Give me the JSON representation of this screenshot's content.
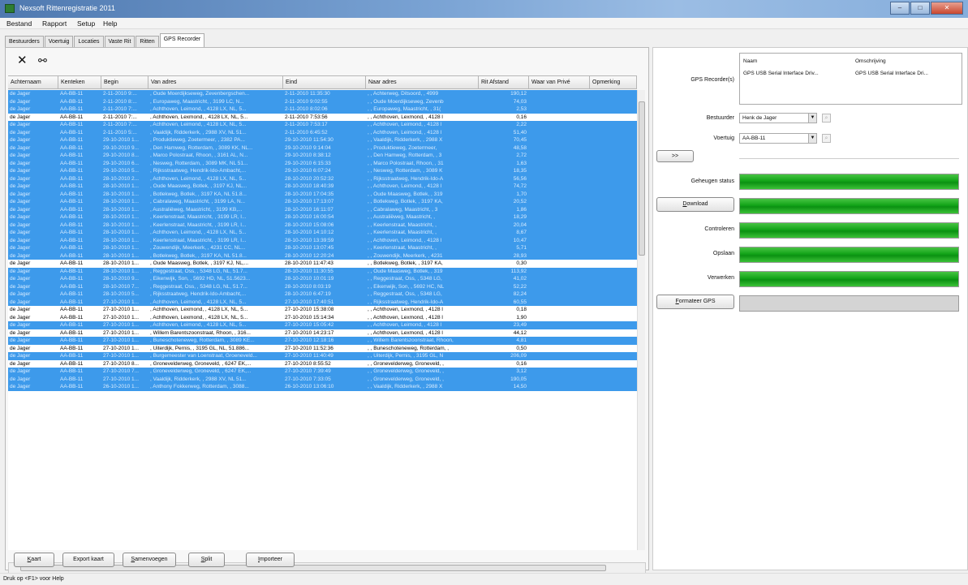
{
  "app": {
    "title": "Nexsoft Rittenregistratie 2011"
  },
  "window_buttons": [
    "–",
    "□",
    "✕"
  ],
  "menu": [
    "Bestand",
    "Rapport",
    "Setup",
    "Help"
  ],
  "tabs": [
    "Bestuurders",
    "Voertuig",
    "Locaties",
    "Vaste Rit",
    "Ritten",
    "GPS Recorder"
  ],
  "active_tab": "GPS Recorder",
  "toolbar": {
    "delete_icon": "close-icon",
    "find_icon": "binoculars-icon"
  },
  "grid": {
    "columns": [
      "Achternaam",
      "Kenteken",
      "Begin",
      "Van adres",
      "Eind",
      "Naar adres",
      "Rit Afstand",
      "Waar van Privé",
      "Opmerking"
    ],
    "rows": [
      {
        "sel": true,
        "name": "de Jager",
        "plate": "AA-BB-11",
        "begin": "2-11-2010 9:...",
        "from": ", Oude Moerdijkseweg, Zevenbergschen...",
        "end": "2-11-2010 11:35:30",
        "to": ", , Achterweg, Ditsoord, , 4999",
        "km": "190,12"
      },
      {
        "sel": true,
        "name": "de Jager",
        "plate": "AA-BB-11",
        "begin": "2-11-2010 8:...",
        "from": ", Europaweg, Maastricht, , 3199 LC, N...",
        "end": "2-11-2010 9:02:55",
        "to": ", , Oude Moerdijkseweg, Zevenb",
        "km": "74,03"
      },
      {
        "sel": true,
        "name": "de Jager",
        "plate": "AA-BB-11",
        "begin": "2-11-2010 7:...",
        "from": ", Achthoven, Leimond, , 4128 LX, NL, 5...",
        "end": "2-11-2010 8:02:06",
        "to": ", , Europaweg, Maastricht, , 31(",
        "km": "2,53"
      },
      {
        "sel": false,
        "name": "de Jager",
        "plate": "AA-BB-11",
        "begin": "2-11-2010 7:...",
        "from": ", Achthoven, Lexmond, , 4128 LX, NL, 5...",
        "end": "2-11-2010 7:53:56",
        "to": ", , Achthoven, Lexmond, , 4128 l",
        "km": "0,16"
      },
      {
        "sel": true,
        "name": "de Jager",
        "plate": "AA-BB-11",
        "begin": "2-11-2010 7:...",
        "from": ", Achthoven, Leimond, , 4128 LX, NL, 5...",
        "end": "2-11-2010 7:53:17",
        "to": ", , Achthoven, Leimond, , 4128 l",
        "km": "2,22"
      },
      {
        "sel": true,
        "name": "de Jager",
        "plate": "AA-BB-11",
        "begin": "2-11-2010 5:...",
        "from": ", Vaaldijk, Ridderkerk, , 2988 XV, NL 51...",
        "end": "2-11-2010 6:45:52",
        "to": ", , Achthoven, Leimond, , 4128 l",
        "km": "51,40"
      },
      {
        "sel": true,
        "name": "de Jager",
        "plate": "AA-BB-11",
        "begin": "29-10-2010 1...",
        "from": ", Produktieweg, Zoetermeer, , 2382 PA...",
        "end": "29-10-2010 11:54:30",
        "to": ", , Vaaldijk, Ridderkerk, , 2988 X",
        "km": "70,45"
      },
      {
        "sel": true,
        "name": "de Jager",
        "plate": "AA-BB-11",
        "begin": "29-10-2010 9...",
        "from": ", Den Hamweg, Rotterdam, , 3089 KK, NL...",
        "end": "29-10-2010 9:14:04",
        "to": ", , Produktieweg, Zoetermeer,",
        "km": "48,58"
      },
      {
        "sel": true,
        "name": "de Jager",
        "plate": "AA-BB-11",
        "begin": "29-10-2010 8...",
        "from": ", Marco Polostraat, Rhoon, , 3161 AL, N...",
        "end": "29-10-2010 8:38:12",
        "to": ", , Den Hamweg, Rotterdam, , 3",
        "km": "2,72"
      },
      {
        "sel": true,
        "name": "de Jager",
        "plate": "AA-BB-11",
        "begin": "29-10-2010 6...",
        "from": ", Nesweg, Rotterdam, , 3089 MK, NL 51...",
        "end": "29-10-2010 6:15:33",
        "to": ", , Marco Polostraat, Rhoon, , 31",
        "km": "1,63"
      },
      {
        "sel": true,
        "name": "de Jager",
        "plate": "AA-BB-11",
        "begin": "29-10-2010 5...",
        "from": ", Rijksstraatweg, Hendrik-Ido-Ambacht,...",
        "end": "29-10-2010 6:07:24",
        "to": ", , Nesweg, Rotterdam, , 3089 K",
        "km": "18,35"
      },
      {
        "sel": true,
        "name": "de Jager",
        "plate": "AA-BB-11",
        "begin": "28-10-2010 2...",
        "from": ", Achthoven, Leimond, , 4128 LX, NL, 5...",
        "end": "28-10-2010 20:52:32",
        "to": ", , Rijksstraatweg, Hendrik-Ido-A",
        "km": "56,56"
      },
      {
        "sel": true,
        "name": "de Jager",
        "plate": "AA-BB-11",
        "begin": "28-10-2010 1...",
        "from": ", Oude Maasweg, Botlek, , 3197 KJ, NL...",
        "end": "28-10-2010 18:40:39",
        "to": ", , Achthoven, Leimond, , 4128 l",
        "km": "74,72"
      },
      {
        "sel": true,
        "name": "de Jager",
        "plate": "AA-BB-11",
        "begin": "28-10-2010 1...",
        "from": ", Botlekweg, Botlek, , 3197 KA, NL 51.8...",
        "end": "28-10-2010 17:04:35",
        "to": ", , Oude Maasweg, Botlek, , 319",
        "km": "1,70"
      },
      {
        "sel": true,
        "name": "de Jager",
        "plate": "AA-BB-11",
        "begin": "28-10-2010 1...",
        "from": ", Cabralaweg, Maastricht, , 3199 LA, N...",
        "end": "28-10-2010 17:13:07",
        "to": ", , Botlekweg, Botlek, , 3197 KA,",
        "km": "20,52"
      },
      {
        "sel": true,
        "name": "de Jager",
        "plate": "AA-BB-11",
        "begin": "28-10-2010 1...",
        "from": ", Australiëweg, Maastricht, , 3199 KB,...",
        "end": "28-10-2010 16:11:07",
        "to": ", , Cabralaweg, Maastricht, , 3",
        "km": "1,86"
      },
      {
        "sel": true,
        "name": "de Jager",
        "plate": "AA-BB-11",
        "begin": "28-10-2010 1...",
        "from": ", Keerlenstraat, Maastricht, , 3199 LR, I...",
        "end": "28-10-2010 16:00:54",
        "to": ", , Australiëweg, Maastricht, ,",
        "km": "18,29"
      },
      {
        "sel": true,
        "name": "de Jager",
        "plate": "AA-BB-11",
        "begin": "28-10-2010 1...",
        "from": ", Keerlenstraat, Maastricht, , 3199 LR, I...",
        "end": "28-10-2010 15:08:06",
        "to": ", , Keerlenstraat, Maastricht, ,",
        "km": "20,04"
      },
      {
        "sel": true,
        "name": "de Jager",
        "plate": "AA-BB-11",
        "begin": "28-10-2010 1...",
        "from": ", Achthoven, Leimond, , 4128 LX, NL, 5...",
        "end": "28-10-2010 14:10:12",
        "to": ", , Keerlenstraat, Maastricht, ,",
        "km": "8,67"
      },
      {
        "sel": true,
        "name": "de Jager",
        "plate": "AA-BB-11",
        "begin": "28-10-2010 1...",
        "from": ", Keerlenstraat, Maastricht, , 3199 LR, I...",
        "end": "28-10-2010 13:39:59",
        "to": ", , Achthoven, Leimond, , 4128 l",
        "km": "10,47"
      },
      {
        "sel": true,
        "name": "de Jager",
        "plate": "AA-BB-11",
        "begin": "28-10-2010 1...",
        "from": ", Zouwendijk, Meerkerk, , 4231 CC, NL...",
        "end": "28-10-2010 13:07:45",
        "to": ", , Keerlenstraat, Maastricht, ,",
        "km": "5,71"
      },
      {
        "sel": true,
        "name": "de Jager",
        "plate": "AA-BB-11",
        "begin": "28-10-2010 1...",
        "from": ", Botlekweg, Botlek, , 3197 KA, NL 51.8...",
        "end": "28-10-2010 12:20:24",
        "to": ", , Zouwendijk, Meerkerk, , 4231",
        "km": "28,93"
      },
      {
        "sel": false,
        "name": "de Jager",
        "plate": "AA-BB-11",
        "begin": "28-10-2010 1...",
        "from": ", Oude Maasweg, Botlek, , 3197 KJ, NL,...",
        "end": "28-10-2010 11:47:43",
        "to": ", , Botlekweg, Botlek, , 3197 KA,",
        "km": "0,30"
      },
      {
        "sel": true,
        "name": "de Jager",
        "plate": "AA-BB-11",
        "begin": "28-10-2010 1...",
        "from": ", Reggestraat, Oss, , 5348 LG, NL, 51.7...",
        "end": "28-10-2010 11:30:55",
        "to": ", , Oude Maasweg, Botlek, , 319",
        "km": "113,92"
      },
      {
        "sel": true,
        "name": "de Jager",
        "plate": "AA-BB-11",
        "begin": "28-10-2010 9...",
        "from": ", Eikenwijk, Son, , 5692 HD, NL, 51.5623...",
        "end": "28-10-2010 10:01:19",
        "to": ", , Reggestraat, Oss, , 5348 LG,",
        "km": "41,02"
      },
      {
        "sel": true,
        "name": "de Jager",
        "plate": "AA-BB-11",
        "begin": "28-10-2010 7...",
        "from": ", Reggestraat, Oss, , 5348 LG, NL, 51.7...",
        "end": "28-10-2010 8:03:19",
        "to": ", , Eikenwijk, Son, , 5692 HC, NL",
        "km": "52,22"
      },
      {
        "sel": true,
        "name": "de Jager",
        "plate": "AA-BB-11",
        "begin": "28-10-2010 5...",
        "from": ", Rijksstraatweg, Hendrik-Ido-Ambacht,...",
        "end": "28-10-2010 6:47:19",
        "to": ", , Reggestraat, Oss, , 5348 LG,",
        "km": "82,24"
      },
      {
        "sel": true,
        "name": "de Jager",
        "plate": "AA-BB-11",
        "begin": "27-10-2010 1...",
        "from": ", Achthoven, Leimond, , 4128 LX, NL, 5...",
        "end": "27-10-2010 17:40:51",
        "to": ", , Rijksstraatweg, Hendrik-Ido-A",
        "km": "60,55"
      },
      {
        "sel": false,
        "name": "de Jager",
        "plate": "AA-BB-11",
        "begin": "27-10-2010 1...",
        "from": ", Achthoven, Lexmond, , 4128 LX, NL, 5...",
        "end": "27-10-2010 15:38:08",
        "to": ", , Achthoven, Lexmond, , 4128 l",
        "km": "0,18"
      },
      {
        "sel": false,
        "name": "de Jager",
        "plate": "AA-BB-11",
        "begin": "27-10-2010 1...",
        "from": ", Achthoven, Lexmond, , 4128 LX, NL, 5...",
        "end": "27-10-2010 15:14:34",
        "to": ", , Achthoven, Lexmond, , 4128 l",
        "km": "1,90"
      },
      {
        "sel": true,
        "name": "de Jager",
        "plate": "AA-BB-11",
        "begin": "27-10-2010 1...",
        "from": ", Achthoven, Leimond, , 4128 LX, NL, 5...",
        "end": "27-10-2010 15:05:42",
        "to": ", , Achthoven, Leimond, , 4128 l",
        "km": "23,49"
      },
      {
        "sel": false,
        "name": "de Jager",
        "plate": "AA-BB-11",
        "begin": "27-10-2010 1...",
        "from": ", Willem Barentszoonstraat, Rhoon, , 316...",
        "end": "27-10-2010 14:23:17",
        "to": ", , Achthoven, Lexmond, , 4128 l",
        "km": "44,12"
      },
      {
        "sel": true,
        "name": "de Jager",
        "plate": "AA-BB-11",
        "begin": "27-10-2010 1...",
        "from": ", Buneschoteneweg, Rotterdam, , 3089 KE...",
        "end": "27-10-2010 12:18:16",
        "to": ", , Willem Barentszoonstraat, Rhoon,",
        "km": "4,81"
      },
      {
        "sel": false,
        "name": "de Jager",
        "plate": "AA-BB-11",
        "begin": "27-10-2010 1...",
        "from": ", Uiterdijk, Pernis, , 3195 GL, NL, 51.886...",
        "end": "27-10-2010 11:52:36",
        "to": ", , Buneschoteneweg, Rotterdam, ,",
        "km": "0,50"
      },
      {
        "sel": true,
        "name": "de Jager",
        "plate": "AA-BB-11",
        "begin": "27-10-2010 1...",
        "from": ", Burgemeester van Loenstraat, Groeneveld...",
        "end": "27-10-2010 11:40:49",
        "to": ", , Uiterdijk, Pernis, , 3195 GL, N",
        "km": "206,09"
      },
      {
        "sel": false,
        "name": "de Jager",
        "plate": "AA-BB-11",
        "begin": "27-10-2010 8...",
        "from": ", Gronevelderweg, Groneveld, , 6247 EK,...",
        "end": "27-10-2010 8:55:52",
        "to": ", , Gronevelderweg, Groneveld, ,",
        "km": "0,16"
      },
      {
        "sel": true,
        "name": "de Jager",
        "plate": "AA-BB-11",
        "begin": "27-10-2010 7...",
        "from": ", Gronevelderweg, Groneveld, , 6247 EK,...",
        "end": "27-10-2010 7:39:49",
        "to": ", , Gronevelderweg, Groneveld, ,",
        "km": "3,12"
      },
      {
        "sel": true,
        "name": "de Jager",
        "plate": "AA-BB-11",
        "begin": "27-10-2010 1...",
        "from": ", Vaaldijk, Ridderkerk, , 2988 XV, NL 51...",
        "end": "27-10-2010 7:33:05",
        "to": ", , Gronevelderweg, Groneveld, ,",
        "km": "190,05"
      },
      {
        "sel": true,
        "name": "de Jager",
        "plate": "AA-BB-11",
        "begin": "26-10-2010 1...",
        "from": ", Anthony Fokkerweg, Rotterdam, , 3088...",
        "end": "26-10-2010 13:06:10",
        "to": ", , Vaaldijk, Ridderkerk, , 2988 X",
        "km": "14,50"
      }
    ]
  },
  "buttons": {
    "kaart": "Kaart",
    "export_kaart": "Export kaart",
    "samenvoegen": "Samenvoegen",
    "split": "Split",
    "importeer": "Importeer"
  },
  "right": {
    "gps_label": "GPS Recorder(s)",
    "gps_list": {
      "headers": [
        "Naam",
        "Omschrijving"
      ],
      "row": [
        "GPS USB Serial Interface Driv...",
        "GPS USB Serial Interface Dri..."
      ]
    },
    "bestuurder_label": "Bestuurder",
    "bestuurder_value": "Henk de Jager",
    "voertuig_label": "Voertuig",
    "voertuig_value": "AA-BB-11",
    "arrow_button": ">>",
    "geheugen_label": "Geheugen status",
    "download_button": "Download",
    "controleren_label": "Controleren",
    "opslaan_label": "Opslaan",
    "verwerken_label": "Verwerken",
    "formateer_button": "Formateer GPS",
    "progress": {
      "geheugen": 1.0,
      "download": 1.0,
      "controleren": 1.0,
      "opslaan": 1.0,
      "verwerken": 1.0,
      "formateer": 0.0
    }
  },
  "status": "Druk op <F1> voor Help",
  "colors": {
    "selection": "#3d9aeb",
    "progress": "#12a318"
  }
}
